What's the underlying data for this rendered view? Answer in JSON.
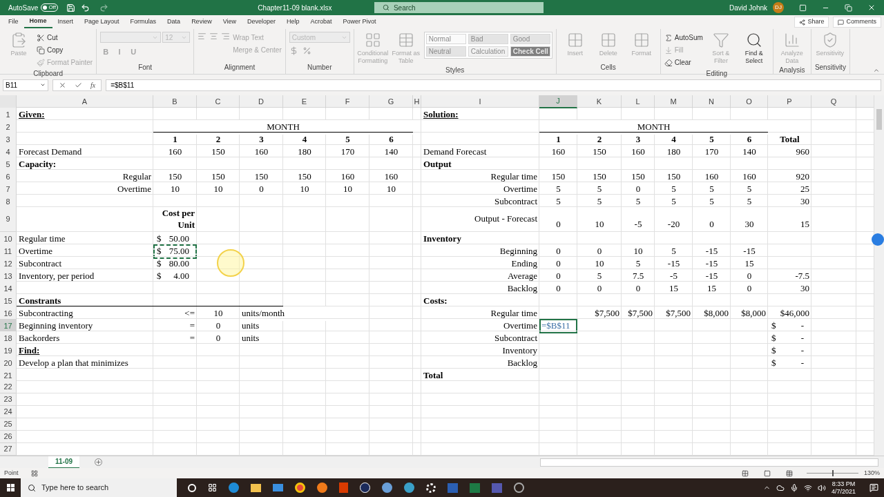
{
  "title_bar": {
    "autosave_label": "AutoSave",
    "autosave": {
      "on": false,
      "label": "Off"
    },
    "file_name": "Chapter11-09 blank.xlsx",
    "search_placeholder": "Search",
    "user_name": "David Johnk",
    "user_initials": "DJ"
  },
  "menu_tabs": [
    {
      "label": "File",
      "selected": false
    },
    {
      "label": "Home",
      "selected": true
    },
    {
      "label": "Insert",
      "selected": false
    },
    {
      "label": "Page Layout",
      "selected": false
    },
    {
      "label": "Formulas",
      "selected": false
    },
    {
      "label": "Data",
      "selected": false
    },
    {
      "label": "Review",
      "selected": false
    },
    {
      "label": "View",
      "selected": false
    },
    {
      "label": "Developer",
      "selected": false
    },
    {
      "label": "Help",
      "selected": false
    },
    {
      "label": "Acrobat",
      "selected": false
    },
    {
      "label": "Power Pivot",
      "selected": false
    }
  ],
  "share_label": "Share",
  "comments_label": "Comments",
  "ribbon": [
    {
      "label": "Clipboard",
      "items": [
        {
          "kind": "large",
          "label": "Paste",
          "disabled": true
        },
        {
          "kind": "small",
          "label": "Cut",
          "disabled": false
        },
        {
          "kind": "small",
          "label": "Copy",
          "disabled": false
        },
        {
          "kind": "small",
          "label": "Format Painter",
          "disabled": true
        }
      ]
    },
    {
      "label": "Font",
      "items": [
        {
          "kind": "field",
          "disabled": true
        },
        {
          "kind": "field",
          "label": "12",
          "disabled": true
        },
        {
          "kind": "letter",
          "label": "B",
          "disabled": true
        },
        {
          "kind": "letter",
          "label": "I",
          "disabled": true
        },
        {
          "kind": "letter",
          "label": "U",
          "disabled": true
        }
      ]
    },
    {
      "label": "Alignment",
      "items": [
        {
          "kind": "align",
          "disabled": true
        },
        {
          "kind": "small",
          "label": "Wrap Text",
          "disabled": true
        },
        {
          "kind": "small",
          "label": "Merge & Center",
          "disabled": true
        }
      ]
    },
    {
      "label": "Number",
      "items": [
        {
          "kind": "field",
          "label": "Custom",
          "disabled": true
        },
        {
          "kind": "numfmt",
          "disabled": true
        }
      ]
    },
    {
      "label": "Styles",
      "items": [
        {
          "kind": "large",
          "label": "Conditional Formatting",
          "disabled": true
        },
        {
          "kind": "large",
          "label": "Format as Table",
          "disabled": true
        }
      ],
      "gallery": [
        {
          "label": "Normal",
          "color": "#fafafa",
          "disabled": true
        },
        {
          "label": "Bad",
          "color": "#e4e4e4",
          "disabled": true
        },
        {
          "label": "Good",
          "color": "#e4e4e4",
          "disabled": true
        },
        {
          "label": "Neutral",
          "color": "#e4e4e4",
          "disabled": true
        },
        {
          "label": "Calculation",
          "color": "#f2f2f2",
          "disabled": true
        },
        {
          "label": "Check Cell",
          "color": "#7f7f7f",
          "disabled": true
        }
      ]
    },
    {
      "label": "Cells",
      "items": [
        {
          "kind": "large",
          "label": "Insert",
          "disabled": true
        },
        {
          "kind": "large",
          "label": "Delete",
          "disabled": true
        },
        {
          "kind": "large",
          "label": "Format",
          "disabled": true
        }
      ]
    },
    {
      "label": "Editing",
      "items": [
        {
          "kind": "small",
          "label": "AutoSum",
          "disabled": false
        },
        {
          "kind": "small",
          "label": "Fill",
          "disabled": true
        },
        {
          "kind": "small",
          "label": "Clear",
          "disabled": false
        },
        {
          "kind": "large",
          "label": "Sort & Filter",
          "disabled": true
        },
        {
          "kind": "large",
          "label": "Find & Select",
          "disabled": false
        }
      ]
    },
    {
      "label": "Analysis",
      "items": [
        {
          "kind": "large",
          "label": "Analyze Data",
          "disabled": true
        }
      ]
    },
    {
      "label": "Sensitivity",
      "items": [
        {
          "kind": "large",
          "label": "Sensitivity",
          "disabled": true
        }
      ]
    }
  ],
  "formula_bar": {
    "name_box": "B11",
    "fx_label": "fx",
    "formula": "=$B$11"
  },
  "columns": [
    {
      "letter": "A",
      "selected": false
    },
    {
      "letter": "B",
      "selected": false
    },
    {
      "letter": "C",
      "selected": false
    },
    {
      "letter": "D",
      "selected": false
    },
    {
      "letter": "E",
      "selected": false
    },
    {
      "letter": "F",
      "selected": false
    },
    {
      "letter": "G",
      "selected": false
    },
    {
      "letter": "H",
      "selected": false
    },
    {
      "letter": "I",
      "selected": false
    },
    {
      "letter": "J",
      "selected": true
    },
    {
      "letter": "K",
      "selected": false
    },
    {
      "letter": "L",
      "selected": false
    },
    {
      "letter": "M",
      "selected": false
    },
    {
      "letter": "N",
      "selected": false
    },
    {
      "letter": "O",
      "selected": false
    },
    {
      "letter": "P",
      "selected": false
    },
    {
      "letter": "Q",
      "selected": false
    }
  ],
  "rows": [
    {
      "number": "1",
      "selected": false,
      "cells": [
        {
          "kind": "title",
          "text": "Given:"
        },
        {},
        {},
        {},
        {},
        {},
        {},
        {},
        {
          "kind": "title",
          "text": "Solution:"
        }
      ]
    },
    {
      "number": "2",
      "selected": false,
      "cells": [
        {},
        {
          "kind": "num",
          "text": "MONTH",
          "rule_below": true
        },
        {
          "kind": "merged",
          "rule_below": true
        },
        {
          "kind": "merged",
          "rule_below": true
        },
        {
          "kind": "merged",
          "rule_below": true
        },
        {
          "kind": "merged",
          "rule_below": true
        },
        {
          "kind": "merged",
          "rule_below": true
        },
        {},
        {},
        {
          "kind": "num",
          "text": "MONTH",
          "rule_below": true
        },
        {
          "kind": "merged",
          "rule_below": true
        },
        {
          "kind": "merged",
          "rule_below": true
        },
        {
          "kind": "merged",
          "rule_below": true
        },
        {
          "kind": "merged",
          "rule_below": true
        },
        {
          "kind": "merged",
          "rule_below": true
        }
      ]
    },
    {
      "number": "3",
      "selected": false,
      "cells": [
        {},
        {
          "kind": "boldnum",
          "text": "1"
        },
        {
          "kind": "boldnum",
          "text": "2"
        },
        {
          "kind": "boldnum",
          "text": "3"
        },
        {
          "kind": "boldnum",
          "text": "4"
        },
        {
          "kind": "boldnum",
          "text": "5"
        },
        {
          "kind": "boldnum",
          "text": "6"
        },
        {},
        {},
        {
          "kind": "boldnum",
          "text": "1"
        },
        {
          "kind": "boldnum",
          "text": "2"
        },
        {
          "kind": "boldnum",
          "text": "3"
        },
        {
          "kind": "boldnum",
          "text": "4"
        },
        {
          "kind": "boldnum",
          "text": "5"
        },
        {
          "kind": "boldnum",
          "text": "6"
        },
        {
          "kind": "boldnum",
          "text": "Total"
        }
      ]
    },
    {
      "number": "4",
      "selected": false,
      "cells": [
        {
          "kind": "text",
          "text": "Forecast Demand"
        },
        {
          "kind": "num",
          "text": "160"
        },
        {
          "kind": "num",
          "text": "150"
        },
        {
          "kind": "num",
          "text": "160"
        },
        {
          "kind": "num",
          "text": "180"
        },
        {
          "kind": "num",
          "text": "170"
        },
        {
          "kind": "num",
          "text": "140"
        },
        {},
        {
          "kind": "text",
          "text": "Demand Forecast"
        },
        {
          "kind": "num",
          "text": "160"
        },
        {
          "kind": "num",
          "text": "150"
        },
        {
          "kind": "num",
          "text": "160"
        },
        {
          "kind": "num",
          "text": "180"
        },
        {
          "kind": "num",
          "text": "170"
        },
        {
          "kind": "num",
          "text": "140"
        },
        {
          "kind": "right",
          "text": "960"
        }
      ]
    },
    {
      "number": "5",
      "selected": false,
      "cells": [
        {
          "kind": "bold",
          "text": "Capacity:"
        },
        {},
        {},
        {},
        {},
        {},
        {},
        {},
        {
          "kind": "bold",
          "text": "Output"
        }
      ]
    },
    {
      "number": "6",
      "selected": false,
      "cells": [
        {
          "kind": "right",
          "text": "Regular"
        },
        {
          "kind": "num",
          "text": "150"
        },
        {
          "kind": "num",
          "text": "150"
        },
        {
          "kind": "num",
          "text": "150"
        },
        {
          "kind": "num",
          "text": "150"
        },
        {
          "kind": "num",
          "text": "160"
        },
        {
          "kind": "num",
          "text": "160"
        },
        {},
        {
          "kind": "right",
          "text": "Regular time"
        },
        {
          "kind": "num",
          "text": "150"
        },
        {
          "kind": "num",
          "text": "150"
        },
        {
          "kind": "num",
          "text": "150"
        },
        {
          "kind": "num",
          "text": "150"
        },
        {
          "kind": "num",
          "text": "160"
        },
        {
          "kind": "num",
          "text": "160"
        },
        {
          "kind": "right",
          "text": "920"
        }
      ]
    },
    {
      "number": "7",
      "selected": false,
      "cells": [
        {
          "kind": "right",
          "text": "Overtime"
        },
        {
          "kind": "num",
          "text": "10"
        },
        {
          "kind": "num",
          "text": "10"
        },
        {
          "kind": "num",
          "text": "0"
        },
        {
          "kind": "num",
          "text": "10"
        },
        {
          "kind": "num",
          "text": "10"
        },
        {
          "kind": "num",
          "text": "10"
        },
        {},
        {
          "kind": "right",
          "text": "Overtime"
        },
        {
          "kind": "num",
          "text": "5"
        },
        {
          "kind": "num",
          "text": "5"
        },
        {
          "kind": "num",
          "text": "0"
        },
        {
          "kind": "num",
          "text": "5"
        },
        {
          "kind": "num",
          "text": "5"
        },
        {
          "kind": "num",
          "text": "5"
        },
        {
          "kind": "right",
          "text": "25"
        }
      ]
    },
    {
      "number": "8",
      "selected": false,
      "cells": [
        {},
        {},
        {},
        {},
        {},
        {},
        {},
        {},
        {
          "kind": "right",
          "text": "Subcontract"
        },
        {
          "kind": "num",
          "text": "5"
        },
        {
          "kind": "num",
          "text": "5"
        },
        {
          "kind": "num",
          "text": "5"
        },
        {
          "kind": "num",
          "text": "5"
        },
        {
          "kind": "num",
          "text": "5"
        },
        {
          "kind": "num",
          "text": "5"
        },
        {
          "kind": "right",
          "text": "30"
        }
      ]
    },
    {
      "number": "9",
      "selected": false,
      "cells": [
        {},
        {
          "kind": "wrap",
          "text": "Cost per Unit"
        },
        {},
        {},
        {},
        {},
        {},
        {},
        {
          "kind": "right-top",
          "text": "Output - Forecast"
        },
        {
          "kind": "num",
          "text": "0"
        },
        {
          "kind": "num",
          "text": "10"
        },
        {
          "kind": "num",
          "text": "-5"
        },
        {
          "kind": "num",
          "text": "-20"
        },
        {
          "kind": "num",
          "text": "0"
        },
        {
          "kind": "num",
          "text": "30"
        },
        {
          "kind": "right",
          "text": "15"
        }
      ]
    },
    {
      "number": "10",
      "selected": false,
      "cells": [
        {
          "kind": "text",
          "text": "Regular time"
        },
        {
          "kind": "acct",
          "symbol": "$",
          "text": "50.00"
        },
        {},
        {},
        {},
        {},
        {},
        {},
        {
          "kind": "bold",
          "text": "Inventory"
        }
      ]
    },
    {
      "number": "11",
      "selected": false,
      "cells": [
        {
          "kind": "text",
          "text": "Overtime"
        },
        {
          "kind": "acct",
          "symbol": "$",
          "text": "75.00",
          "copied": true
        },
        {},
        {},
        {},
        {},
        {},
        {},
        {
          "kind": "right",
          "text": "Beginning"
        },
        {
          "kind": "num",
          "text": "0"
        },
        {
          "kind": "num",
          "text": "0"
        },
        {
          "kind": "num",
          "text": "10"
        },
        {
          "kind": "num",
          "text": "5"
        },
        {
          "kind": "num",
          "text": "-15"
        },
        {
          "kind": "num",
          "text": "-15"
        }
      ]
    },
    {
      "number": "12",
      "selected": false,
      "cells": [
        {
          "kind": "text",
          "text": "Subcontract"
        },
        {
          "kind": "acct",
          "symbol": "$",
          "text": "80.00"
        },
        {},
        {},
        {},
        {},
        {},
        {},
        {
          "kind": "right",
          "text": "Ending"
        },
        {
          "kind": "num",
          "text": "0"
        },
        {
          "kind": "num",
          "text": "10"
        },
        {
          "kind": "num",
          "text": "5"
        },
        {
          "kind": "num",
          "text": "-15"
        },
        {
          "kind": "num",
          "text": "-15"
        },
        {
          "kind": "num",
          "text": "15"
        }
      ]
    },
    {
      "number": "13",
      "selected": false,
      "cells": [
        {
          "kind": "text",
          "text": "Inventory, per period"
        },
        {
          "kind": "acct",
          "symbol": "$",
          "text": "4.00"
        },
        {},
        {},
        {},
        {},
        {},
        {},
        {
          "kind": "right",
          "text": "Average"
        },
        {
          "kind": "num",
          "text": "0"
        },
        {
          "kind": "num",
          "text": "5"
        },
        {
          "kind": "num",
          "text": "7.5"
        },
        {
          "kind": "num",
          "text": "-5"
        },
        {
          "kind": "num",
          "text": "-15"
        },
        {
          "kind": "num",
          "text": "0"
        },
        {
          "kind": "right",
          "text": "-7.5"
        }
      ]
    },
    {
      "number": "14",
      "selected": false,
      "cells": [
        {},
        {},
        {},
        {},
        {},
        {},
        {},
        {},
        {
          "kind": "right",
          "text": "Backlog"
        },
        {
          "kind": "num",
          "text": "0"
        },
        {
          "kind": "num",
          "text": "0"
        },
        {
          "kind": "num",
          "text": "0"
        },
        {
          "kind": "num",
          "text": "15"
        },
        {
          "kind": "num",
          "text": "15"
        },
        {
          "kind": "num",
          "text": "0"
        },
        {
          "kind": "right",
          "text": "30"
        }
      ]
    },
    {
      "number": "15",
      "selected": false,
      "cells": [
        {
          "kind": "bold",
          "text": "Constrants",
          "rule_below": true
        },
        {
          "rule_below": true
        },
        {
          "rule_below": true
        },
        {
          "rule_below": true
        },
        {},
        {},
        {},
        {},
        {
          "kind": "bold",
          "text": "Costs:"
        }
      ]
    },
    {
      "number": "16",
      "selected": false,
      "cells": [
        {
          "kind": "text",
          "text": "Subcontracting"
        },
        {
          "kind": "right",
          "text": "<="
        },
        {
          "kind": "num",
          "text": "10"
        },
        {
          "kind": "text",
          "text": "units/month"
        },
        {
          "kind": "merged"
        },
        {},
        {},
        {},
        {
          "kind": "right",
          "text": "Regular time"
        },
        {},
        {
          "kind": "right",
          "text": "$7,500"
        },
        {
          "kind": "right",
          "text": "$7,500"
        },
        {
          "kind": "right",
          "text": "$7,500"
        },
        {
          "kind": "right",
          "text": "$8,000"
        },
        {
          "kind": "right",
          "text": "$8,000"
        },
        {
          "kind": "right",
          "text": "$46,000"
        }
      ]
    },
    {
      "number": "17",
      "selected": true,
      "cells": [
        {
          "kind": "text",
          "text": "Beginning inventory"
        },
        {
          "kind": "right",
          "text": "="
        },
        {
          "kind": "num",
          "text": "0"
        },
        {
          "kind": "text",
          "text": "units"
        },
        {},
        {},
        {},
        {},
        {
          "kind": "right",
          "text": "Overtime"
        },
        {
          "kind": "text",
          "text": "=$B$11",
          "editing": true
        },
        {},
        {},
        {},
        {},
        {},
        {
          "kind": "acct",
          "symbol": "$",
          "text": "-"
        }
      ]
    },
    {
      "number": "18",
      "selected": false,
      "cells": [
        {
          "kind": "text",
          "text": "Backorders"
        },
        {
          "kind": "right",
          "text": "="
        },
        {
          "kind": "num",
          "text": "0"
        },
        {
          "kind": "text",
          "text": "units"
        },
        {},
        {},
        {},
        {},
        {
          "kind": "right",
          "text": "Subcontract"
        },
        {},
        {},
        {},
        {},
        {},
        {},
        {
          "kind": "acct",
          "symbol": "$",
          "text": "-"
        }
      ]
    },
    {
      "number": "19",
      "selected": false,
      "cells": [
        {
          "kind": "title",
          "text": "Find:"
        },
        {},
        {},
        {},
        {},
        {},
        {},
        {},
        {
          "kind": "right",
          "text": "Inventory"
        },
        {},
        {},
        {},
        {},
        {},
        {},
        {
          "kind": "acct",
          "symbol": "$",
          "text": "-"
        }
      ]
    },
    {
      "number": "20",
      "selected": false,
      "cells": [
        {
          "kind": "text",
          "text": "Develop a plan that minimizes"
        },
        {},
        {},
        {},
        {},
        {},
        {},
        {},
        {
          "kind": "right",
          "text": "Backlog"
        },
        {},
        {},
        {},
        {},
        {},
        {},
        {
          "kind": "acct",
          "symbol": "$",
          "text": "-"
        }
      ]
    },
    {
      "number": "21",
      "selected": false,
      "cells": [
        {},
        {},
        {},
        {},
        {},
        {},
        {},
        {},
        {
          "kind": "bold",
          "text": "Total"
        }
      ]
    },
    {
      "number": "22",
      "selected": false
    },
    {
      "number": "23",
      "selected": false
    },
    {
      "number": "24",
      "selected": false
    },
    {
      "number": "25",
      "selected": false
    },
    {
      "number": "26",
      "selected": false
    },
    {
      "number": "27",
      "selected": false
    }
  ],
  "sheet_tabs": [
    {
      "label": "11-09",
      "selected": true
    }
  ],
  "status_bar": {
    "mode": "Point",
    "zoom_slider": {
      "level": 0.5
    },
    "zoom": "130%"
  },
  "taskbar": {
    "search_placeholder": "Type here to search",
    "time": "8:33 PM",
    "date": "4/7/2021"
  }
}
